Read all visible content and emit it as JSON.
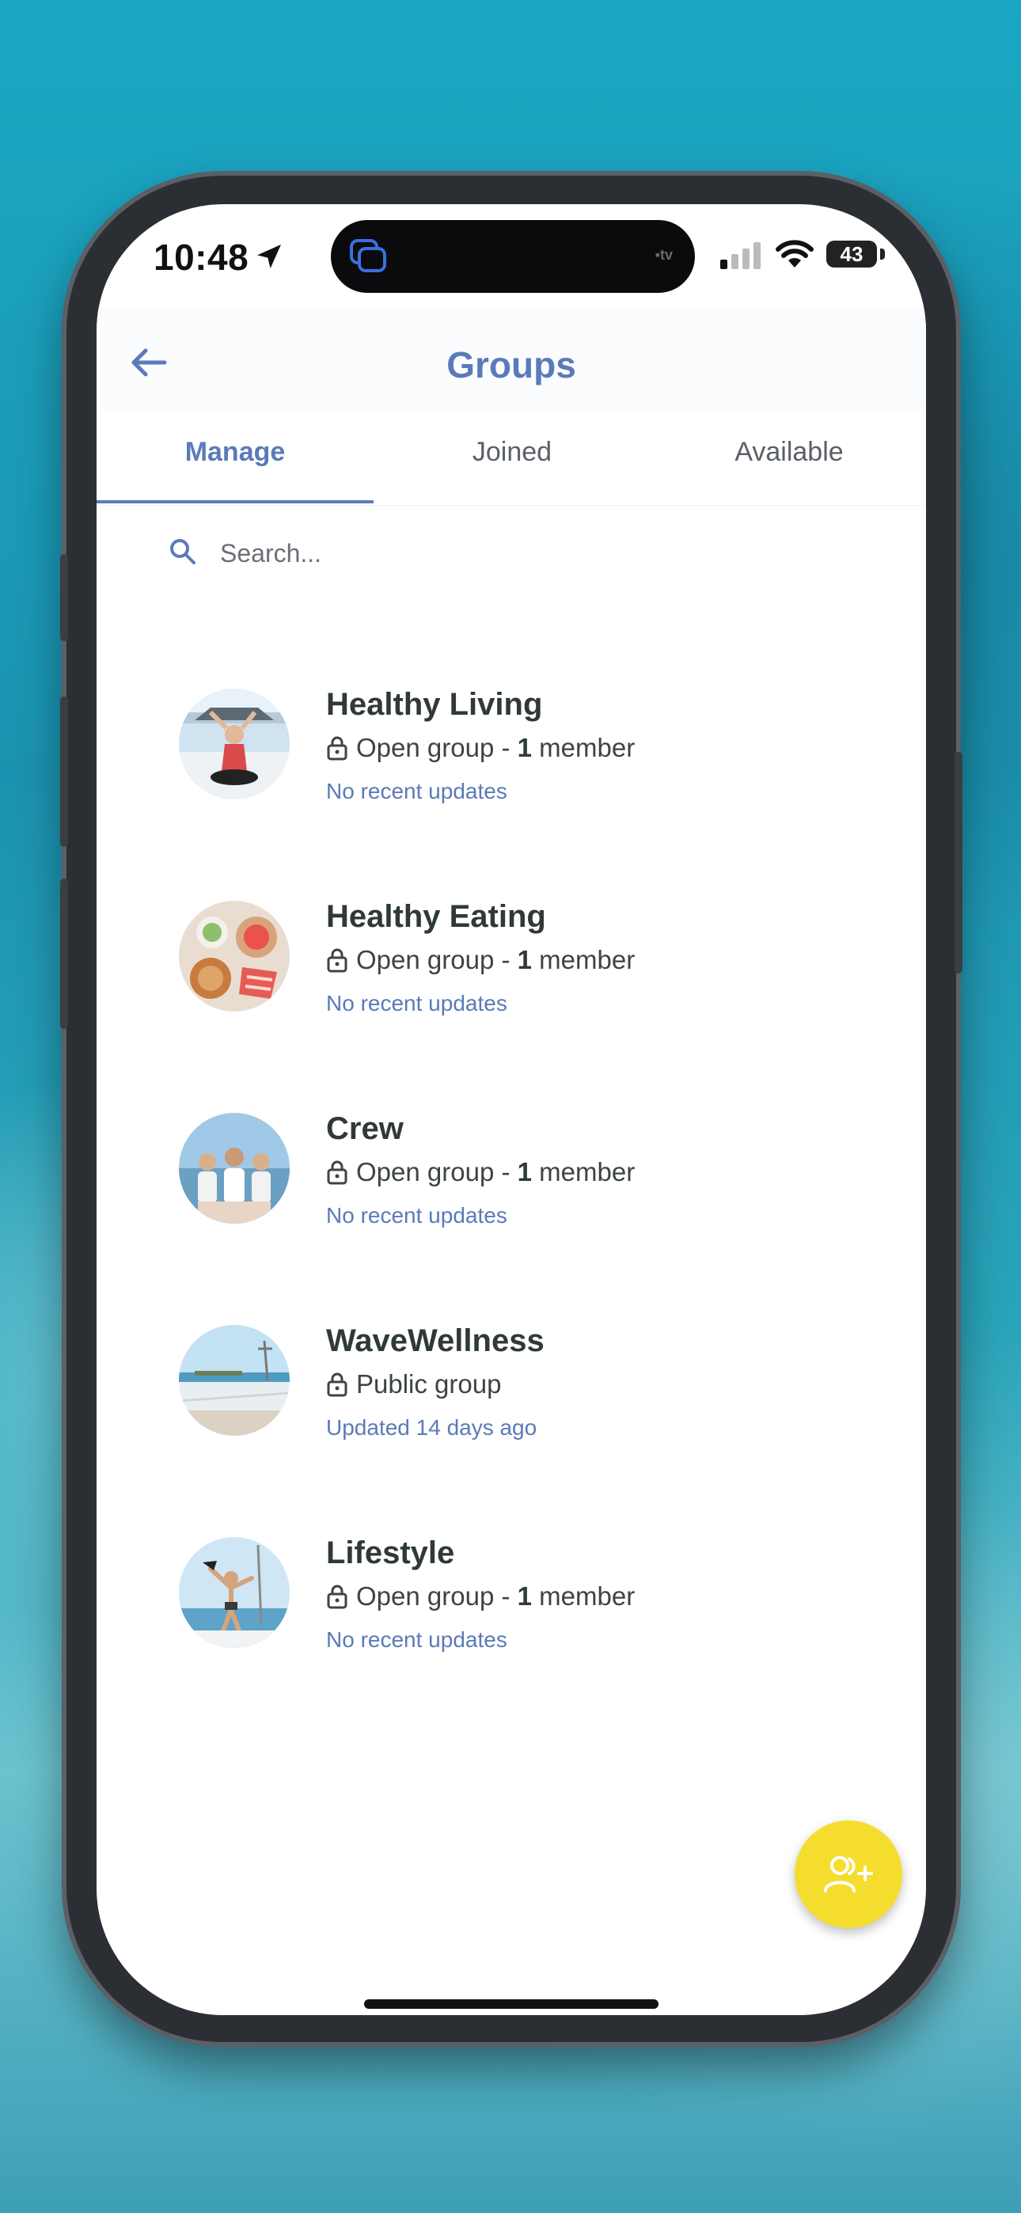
{
  "status_bar": {
    "time": "10:48",
    "battery": "43"
  },
  "header": {
    "title": "Groups"
  },
  "tabs": [
    {
      "label": "Manage",
      "active": true
    },
    {
      "label": "Joined",
      "active": false
    },
    {
      "label": "Available",
      "active": false
    }
  ],
  "search": {
    "placeholder": "Search..."
  },
  "groups": [
    {
      "name": "Healthy Living",
      "type": "Open group",
      "separator": " - ",
      "count": "1",
      "count_label": " member",
      "update": "No recent updates"
    },
    {
      "name": "Healthy Eating",
      "type": "Open group",
      "separator": " - ",
      "count": "1",
      "count_label": " member",
      "update": "No recent updates"
    },
    {
      "name": "Crew",
      "type": "Open group",
      "separator": " - ",
      "count": "1",
      "count_label": " member",
      "update": "No recent updates"
    },
    {
      "name": "WaveWellness",
      "type": "Public group",
      "separator": "",
      "count": "",
      "count_label": "",
      "update": "Updated 14 days ago"
    },
    {
      "name": "Lifestyle",
      "type": "Open group",
      "separator": " - ",
      "count": "1",
      "count_label": " member",
      "update": "No recent updates"
    }
  ],
  "icons": {
    "back": "arrow-left-icon",
    "search": "search-icon",
    "lock": "lock-icon",
    "fab": "add-group-icon"
  },
  "colors": {
    "accent": "#5b7ab8",
    "fab": "#f5dd2e"
  }
}
